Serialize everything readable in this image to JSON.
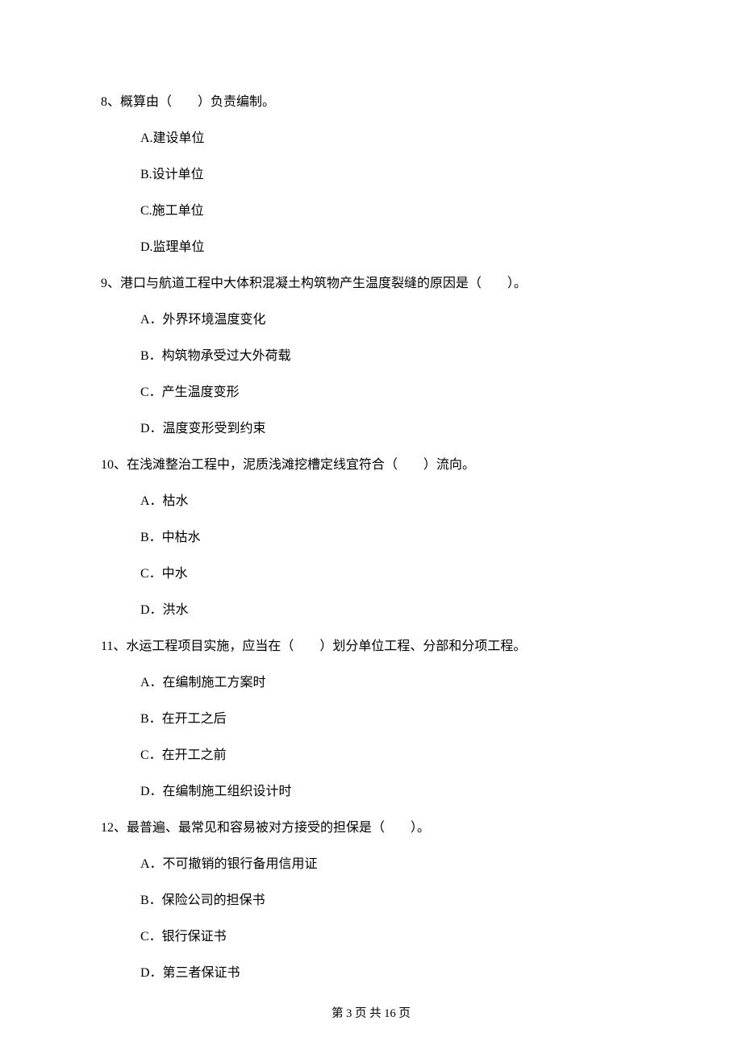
{
  "questions": [
    {
      "stem": "8、概算由（　　）负责编制。",
      "options": [
        "A.建设单位",
        "B.设计单位",
        "C.施工单位",
        "D.监理单位"
      ]
    },
    {
      "stem": "9、港口与航道工程中大体积混凝土构筑物产生温度裂缝的原因是（　　）。",
      "options": [
        "A．外界环境温度变化",
        "B．构筑物承受过大外荷载",
        "C．产生温度变形",
        "D．温度变形受到约束"
      ]
    },
    {
      "stem": "10、在浅滩整治工程中，泥质浅滩挖槽定线宜符合（　　）流向。",
      "options": [
        "A．枯水",
        "B．中枯水",
        "C．中水",
        "D．洪水"
      ]
    },
    {
      "stem": "11、水运工程项目实施，应当在（　　）划分单位工程、分部和分项工程。",
      "options": [
        "A．在编制施工方案时",
        "B．在开工之后",
        "C．在开工之前",
        "D．在编制施工组织设计时"
      ]
    },
    {
      "stem": "12、最普遍、最常见和容易被对方接受的担保是（　　）。",
      "options": [
        "A．不可撤销的银行备用信用证",
        "B．保险公司的担保书",
        "C．银行保证书",
        "D．第三者保证书"
      ]
    }
  ],
  "footer": "第 3 页 共 16 页"
}
